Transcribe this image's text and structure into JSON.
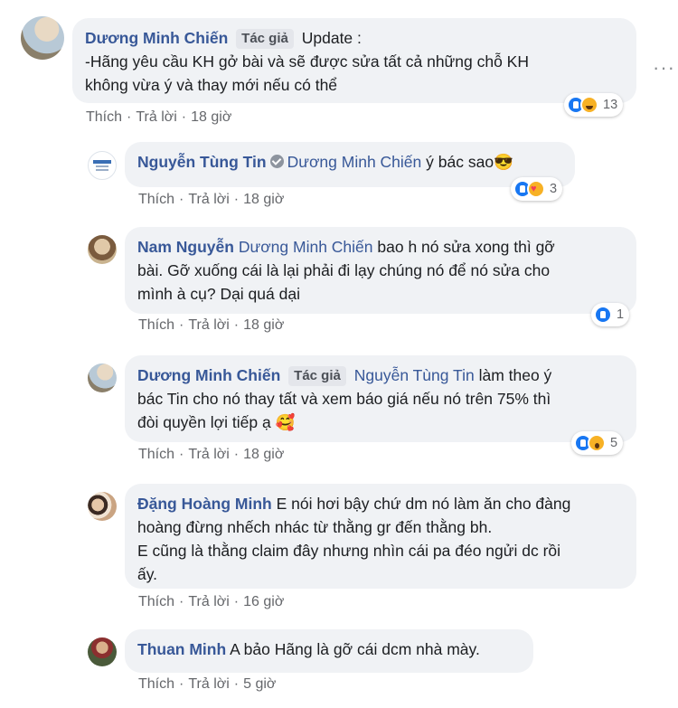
{
  "comments": [
    {
      "author": "Dương Minh Chiến",
      "badge": "Tác giả",
      "text": "Update :\n-Hãng yêu cầu KH gở bài và sẽ được sửa tất cả những chỗ KH không vừa ý và thay mới nếu có thể",
      "line1": "Update :",
      "line2": "-Hãng yêu cầu KH gở bài và sẽ được sửa tất cả những chỗ KH",
      "line3": "không vừa ý và thay mới nếu có thể",
      "like": "Thích",
      "reply": "Trả lời",
      "time": "18 giờ",
      "reaction_count": "13",
      "reactions": [
        "like",
        "haha"
      ]
    },
    {
      "author": "Nguyễn Tùng Tin",
      "mention": "Dương Minh Chiến",
      "text": "ý bác sao😎",
      "like": "Thích",
      "reply": "Trả lời",
      "time": "18 giờ",
      "reaction_count": "3",
      "reactions": [
        "like",
        "love"
      ]
    },
    {
      "author": "Nam Nguyễn",
      "mention": "Dương Minh Chiến",
      "line1": "bao h nó sửa xong thì gỡ",
      "line2": "bài. Gỡ xuống cái là lại phải đi lạy chúng nó để nó sửa cho",
      "line3": "mình à cụ? Dại quá dại",
      "like": "Thích",
      "reply": "Trả lời",
      "time": "18 giờ",
      "reaction_count": "1",
      "reactions": [
        "like"
      ]
    },
    {
      "author": "Dương Minh Chiến",
      "badge": "Tác giả",
      "mention": "Nguyễn Tùng Tin",
      "line1": "làm theo ý",
      "line2": "bác Tin cho nó thay tất và xem báo giá nếu nó trên 75% thì",
      "line3": "đòi quyền lợi tiếp ạ 🥰",
      "like": "Thích",
      "reply": "Trả lời",
      "time": "18 giờ",
      "reaction_count": "5",
      "reactions": [
        "like",
        "wow"
      ]
    },
    {
      "author": "Đặng Hoàng Minh",
      "line1": "E nói hơi bậy chứ dm nó làm ăn cho đàng",
      "line2": "hoàng đừng nhếch nhác từ thằng gr đến thằng bh.",
      "line3": "E cũng là thằng claim đây nhưng nhìn cái pa đéo ngửi dc rồi",
      "line4": "ấy.",
      "like": "Thích",
      "reply": "Trả lời",
      "time": "16 giờ"
    },
    {
      "author": "Thuan Minh",
      "text": "A bảo Hãng là gỡ cái dcm nhà mày.",
      "like": "Thích",
      "reply": "Trả lời",
      "time": "5 giờ"
    }
  ],
  "more_icon": "ellipsis-icon",
  "colors": {
    "bubble": "#f0f2f5",
    "author": "#385898",
    "meta": "#65676b",
    "like": "#1877f2"
  }
}
